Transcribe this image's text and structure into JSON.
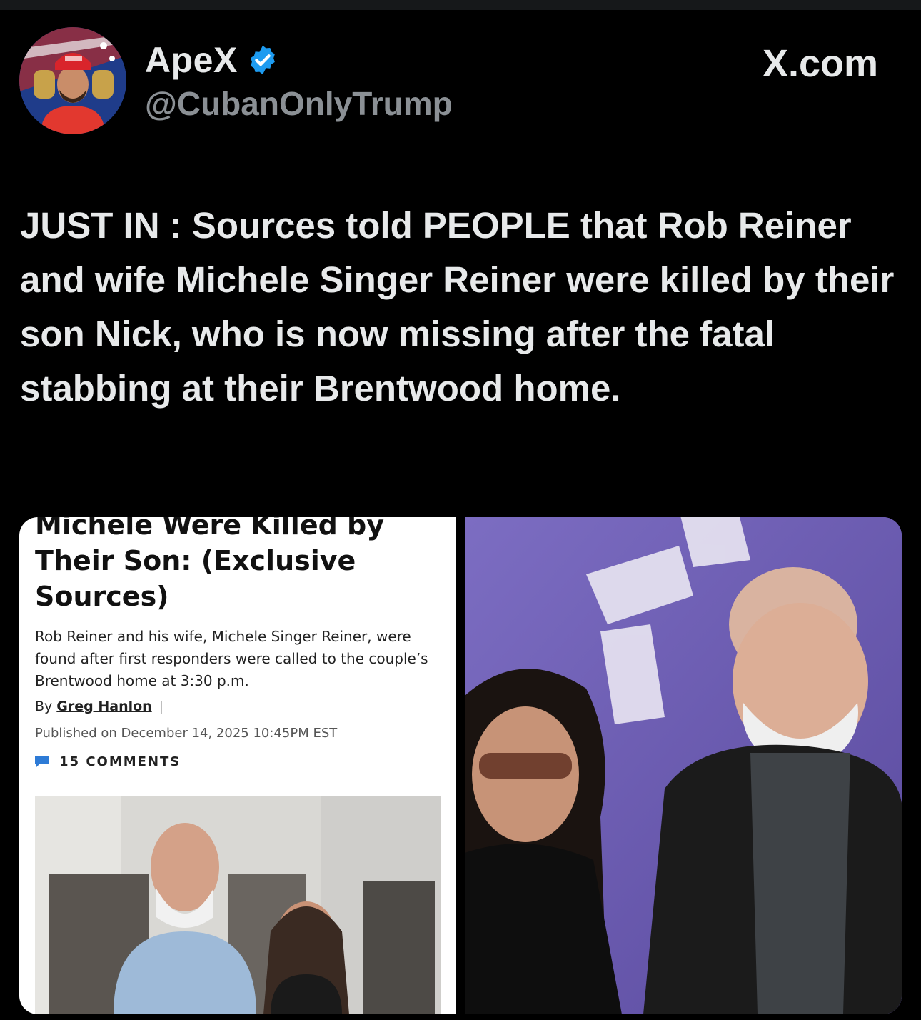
{
  "app": {
    "site": "X.com"
  },
  "profile": {
    "display_name": "ApeX",
    "handle": "@CubanOnlyTrump",
    "verified": true,
    "avatar_icon": "avatar-photo"
  },
  "tweet": {
    "text": "JUST IN : Sources told PEOPLE that Rob Reiner and wife Michele Singer Reiner were killed by their son Nick, who is now missing after the fatal stabbing at their Brentwood home."
  },
  "article_card": {
    "headline": "Michele Were Killed by Their Son: (Exclusive Sources)",
    "summary": "Rob Reiner and his wife, Michele Singer Reiner, were found after first responders were called to the couple’s Brentwood home at 3:30 p.m.",
    "by_label": "By",
    "author": "Greg Hanlon",
    "author_sep": "|",
    "published": "Published on December 14, 2025 10:45PM EST",
    "comments": "15 COMMENTS"
  },
  "colors": {
    "background": "#000000",
    "text_primary": "#e7e9ea",
    "text_secondary": "#8b9095",
    "verified_blue": "#1d9bf0",
    "comment_icon_blue": "#2e7bd6",
    "photo_bg_purple": "#6a5bb3"
  }
}
